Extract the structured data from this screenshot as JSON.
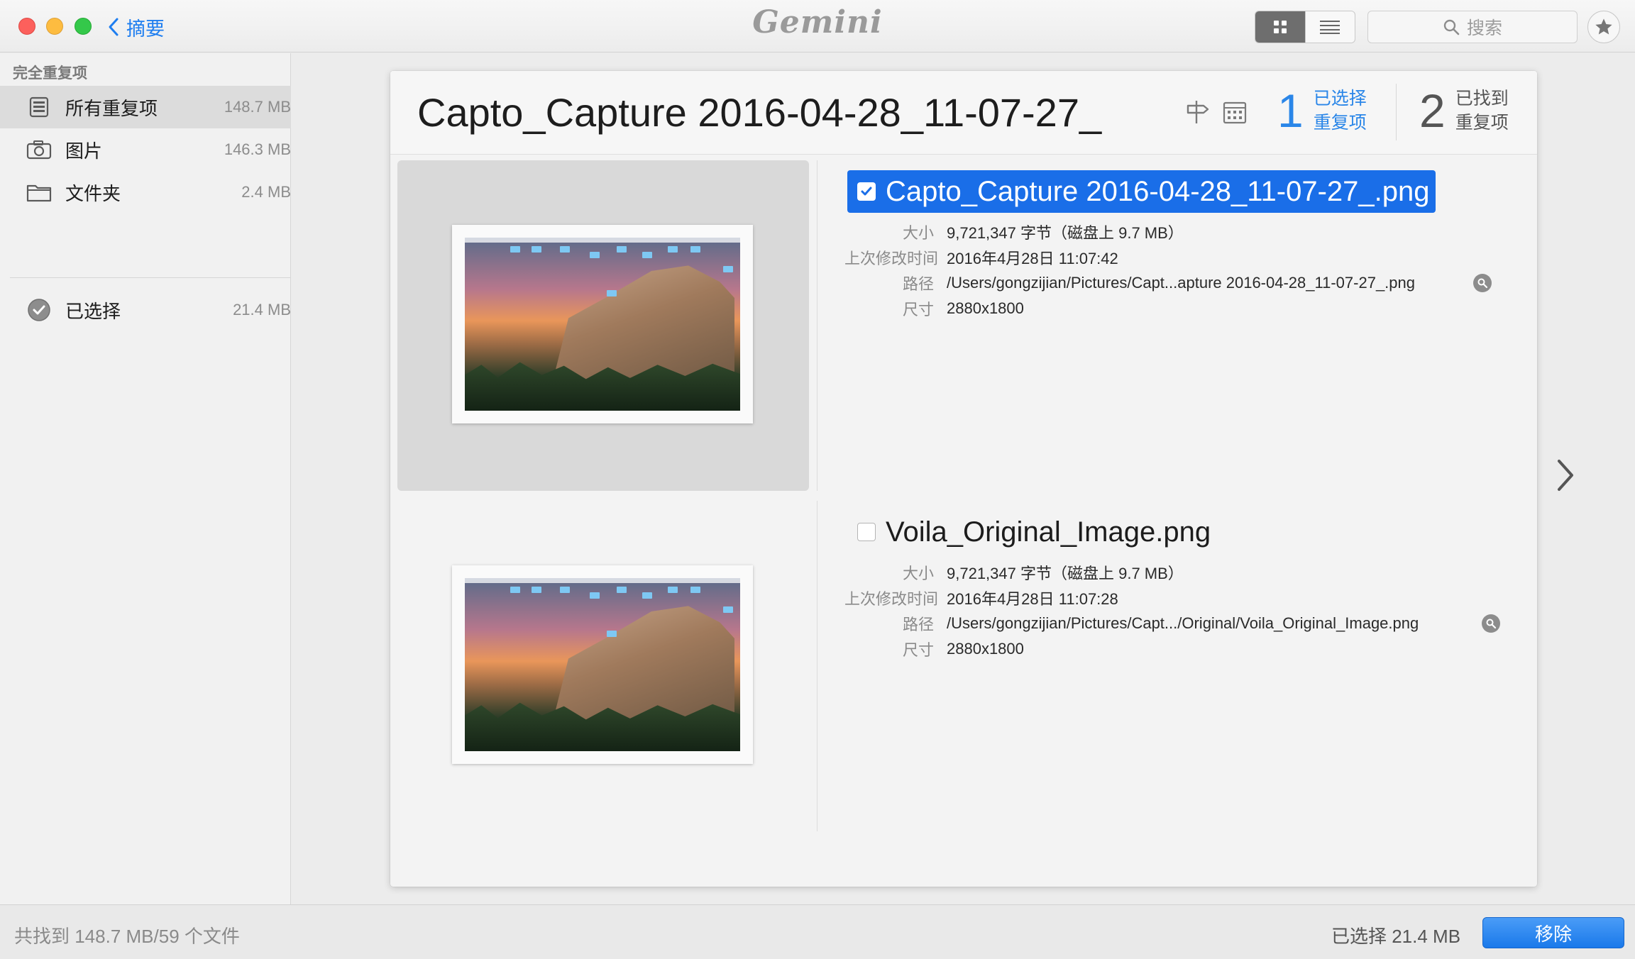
{
  "toolbar": {
    "back_label": "摘要",
    "logo": "Gemini",
    "search_placeholder": "搜索"
  },
  "sidebar": {
    "section_title": "完全重复项",
    "items": [
      {
        "label": "所有重复项",
        "size": "148.7 MB",
        "icon": "tray-stack-icon",
        "selected": true
      },
      {
        "label": "图片",
        "size": "146.3 MB",
        "icon": "camera-icon",
        "selected": false
      },
      {
        "label": "文件夹",
        "size": "2.4 MB",
        "icon": "folder-icon",
        "selected": false
      }
    ],
    "selected_item": {
      "label": "已选择",
      "size": "21.4 MB",
      "icon": "checkmark-circle-icon"
    }
  },
  "detail": {
    "title": "Capto_Capture 2016-04-28_11-07-27_",
    "selected_count": "1",
    "selected_label_line1": "已选择",
    "selected_label_line2": "重复项",
    "found_count": "2",
    "found_label_line1": "已找到",
    "found_label_line2": "重复项",
    "files": [
      {
        "name": "Capto_Capture 2016-04-28_11-07-27_.png",
        "checked": true,
        "size_label": "大小",
        "size": "9,721,347 字节（磁盘上 9.7 MB）",
        "modified_label": "上次修改时间",
        "modified": "2016年4月28日 11:07:42",
        "path_label": "路径",
        "path": "/Users/gongzijian/Pictures/Capt...apture 2016-04-28_11-07-27_.png",
        "dims_label": "尺寸",
        "dims": "2880x1800"
      },
      {
        "name": "Voila_Original_Image.png",
        "checked": false,
        "size_label": "大小",
        "size": "9,721,347 字节（磁盘上 9.7 MB）",
        "modified_label": "上次修改时间",
        "modified": "2016年4月28日 11:07:28",
        "path_label": "路径",
        "path": "/Users/gongzijian/Pictures/Capt.../Original/Voila_Original_Image.png",
        "dims_label": "尺寸",
        "dims": "2880x1800"
      }
    ]
  },
  "status": {
    "found_summary": "共找到 148.7 MB/59 个文件",
    "selected_summary": "已选择 21.4 MB",
    "remove_label": "移除"
  },
  "colors": {
    "accent": "#1a6ee8",
    "count_blue": "#2a86e8",
    "remove_button": "#1a79ea"
  }
}
